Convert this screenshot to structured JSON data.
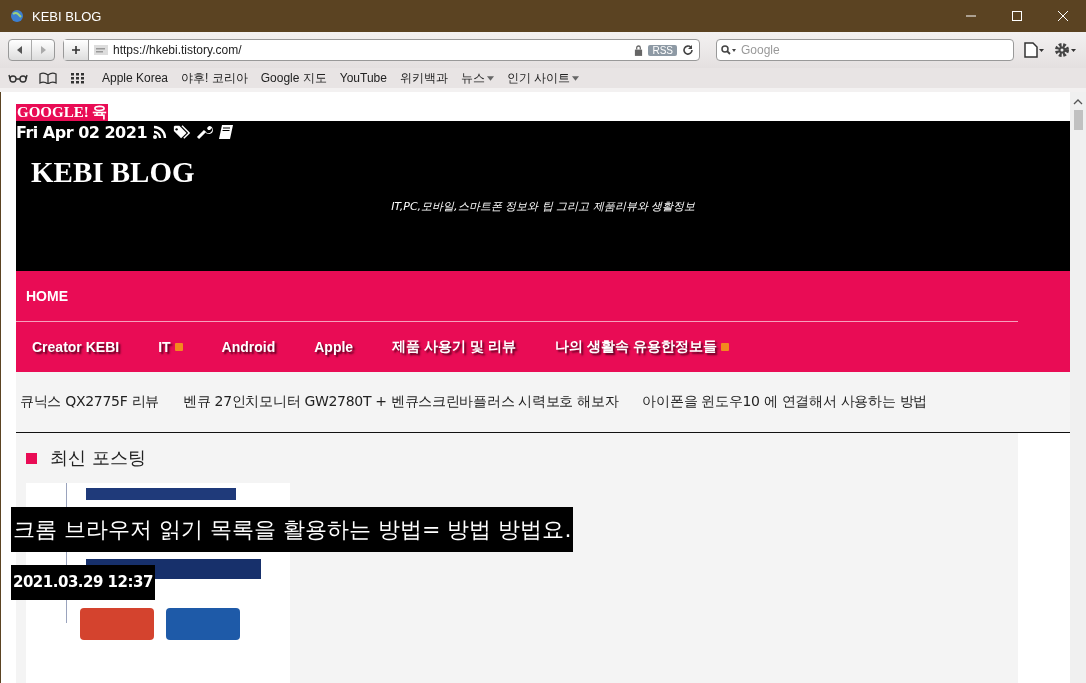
{
  "window": {
    "title": "KEBI BLOG"
  },
  "toolbar": {
    "url": "https://hkebi.tistory.com/",
    "rss": "RSS",
    "search": {
      "placeholder": "Google"
    }
  },
  "bookmarks": [
    {
      "label": "Apple Korea",
      "menu": false
    },
    {
      "label": "야후! 코리아",
      "menu": false
    },
    {
      "label": "Google 지도",
      "menu": false
    },
    {
      "label": "YouTube",
      "menu": false
    },
    {
      "label": "위키백과",
      "menu": false
    },
    {
      "label": "뉴스",
      "menu": true
    },
    {
      "label": "인기 사이트",
      "menu": true
    }
  ],
  "page": {
    "badge": "GOOGLE! 육",
    "date": "Fri Apr 02 2021",
    "title": "KEBI BLOG",
    "tagline": "IT,PC,모바일,스마트폰 정보와 팁 그리고 제품리뷰와 생활정보",
    "home": "HOME",
    "menu": [
      {
        "label": "Creator KEBI",
        "new": false
      },
      {
        "label": "IT",
        "new": true
      },
      {
        "label": "Android",
        "new": false
      },
      {
        "label": "Apple",
        "new": false
      },
      {
        "label": "제품 사용기 및 리뷰",
        "new": false
      },
      {
        "label": "나의 생활속 유용한정보들",
        "new": true
      }
    ],
    "top_posts": [
      "큐닉스 QX2775F 리뷰",
      "벤큐 27인치모니터 GW2780T + 벤큐스크린바플러스 시력보호 해보자",
      "아이폰을 윈도우10 에 연결해서 사용하는 방법"
    ],
    "section": "최신 포스팅",
    "post": {
      "title": "크롬 브라우저 읽기 목록을 활용하는 방법= 방법 방법요.",
      "date": "2021.03.29 12:37"
    }
  }
}
